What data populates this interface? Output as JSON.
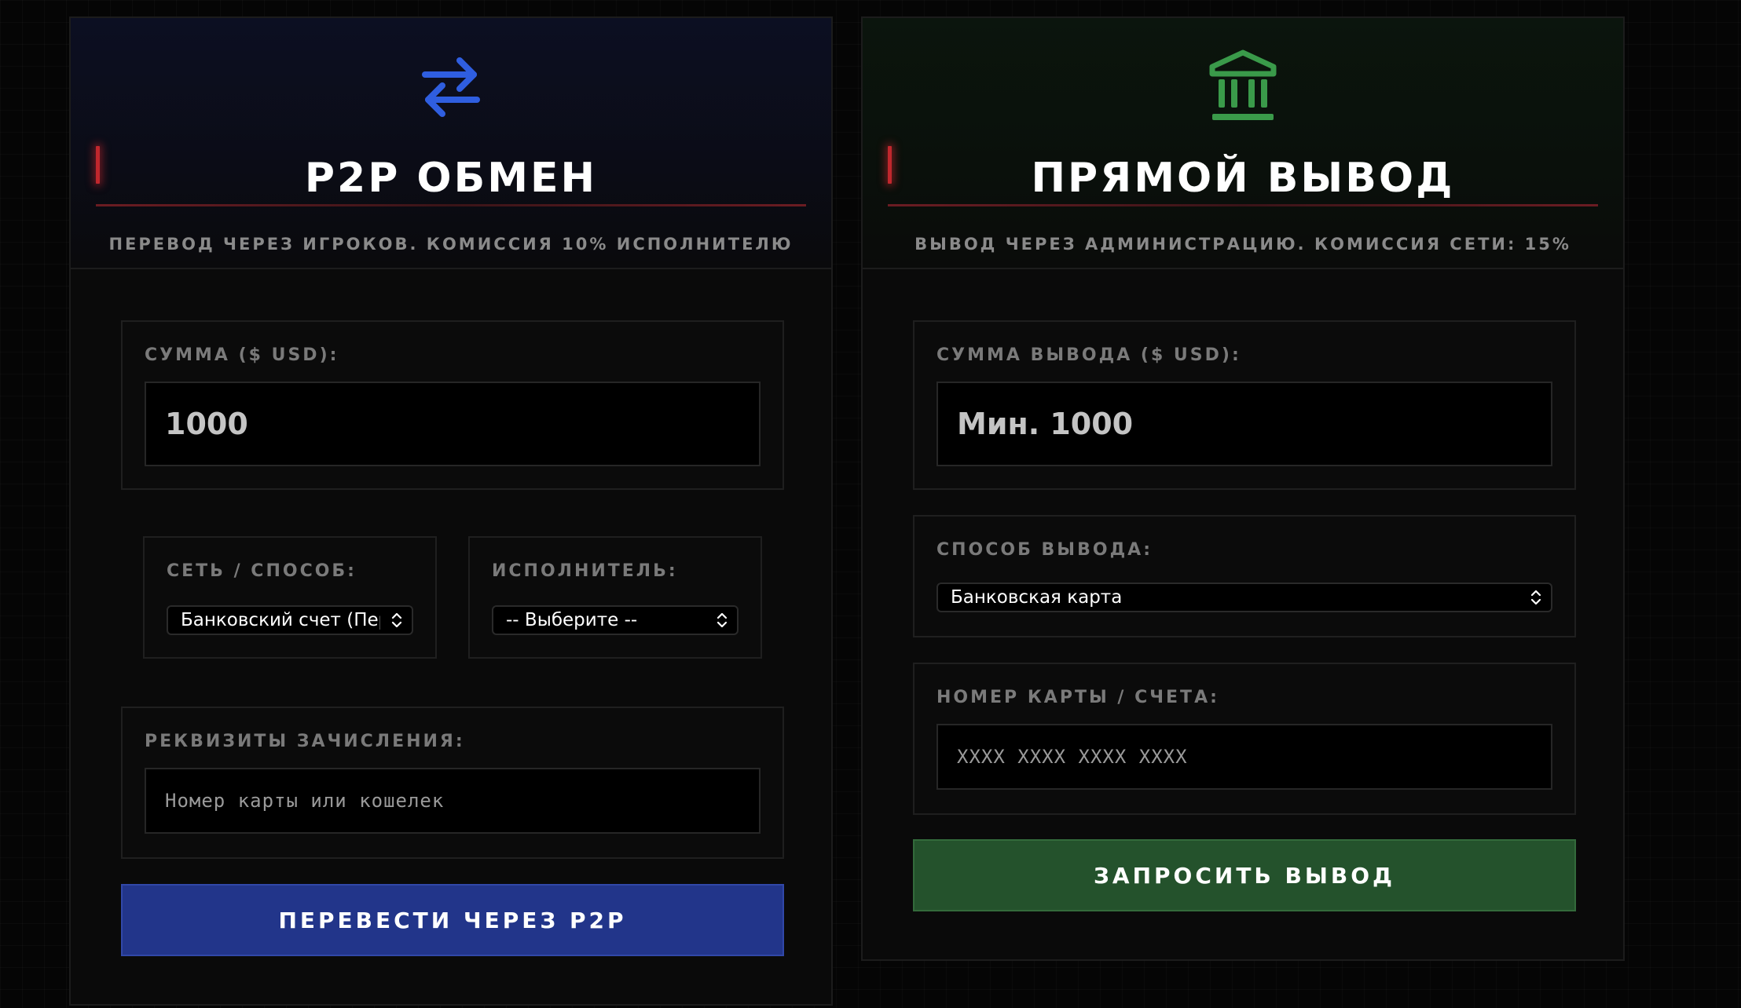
{
  "p2p": {
    "icon": "arrows-exchange-icon",
    "icon_color": "#2f5ee0",
    "title": "P2P ОБМЕН",
    "subtitle": "ПЕРЕВОД ЧЕРЕЗ ИГРОКОВ. КОМИССИЯ 10% ИСПОЛНИТЕЛЮ",
    "amount": {
      "label": "СУММА ($ USD):",
      "value": "1000"
    },
    "network": {
      "label": "СЕТЬ / СПОСОБ:",
      "selected": "Банковский счет (Перевод)"
    },
    "executor": {
      "label": "ИСПОЛНИТЕЛЬ:",
      "selected": "-- Выберите --"
    },
    "details": {
      "label": "РЕКВИЗИТЫ ЗАЧИСЛЕНИЯ:",
      "placeholder": "Номер карты или кошелек"
    },
    "submit_label": "ПЕРЕВЕСТИ ЧЕРЕЗ P2P",
    "button_color": "#22358a"
  },
  "direct": {
    "icon": "bank-icon",
    "icon_color": "#3a9a4a",
    "title": "ПРЯМОЙ ВЫВОД",
    "subtitle": "ВЫВОД ЧЕРЕЗ АДМИНИСТРАЦИЮ. КОМИССИЯ СЕТИ: 15%",
    "amount": {
      "label": "СУММА ВЫВОДА ($ USD):",
      "placeholder": "Мин. 1000"
    },
    "method": {
      "label": "СПОСОБ ВЫВОДА:",
      "selected": "Банковская карта"
    },
    "account": {
      "label": "НОМЕР КАРТЫ / СЧЕТА:",
      "placeholder": "XXXX XXXX XXXX XXXX"
    },
    "submit_label": "ЗАПРОСИТЬ ВЫВОД",
    "button_color": "#24522c"
  },
  "accent_color": "#c0272d"
}
